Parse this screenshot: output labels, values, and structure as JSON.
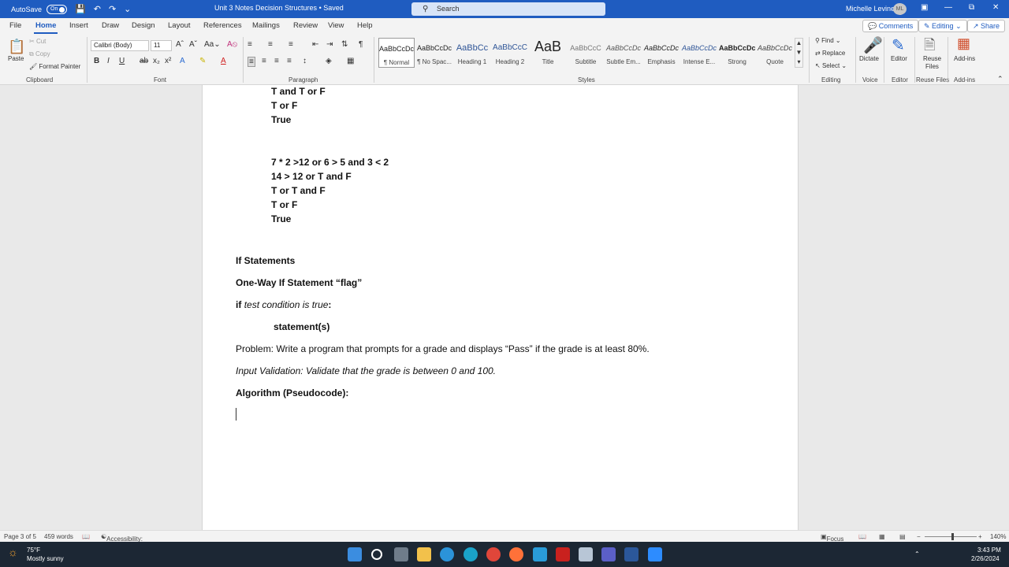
{
  "titlebar": {
    "autosave_label": "AutoSave",
    "autosave_state": "On",
    "doc_title": "Unit 3 Notes Decision Structures",
    "saved_status": "• Saved",
    "search_placeholder": "Search",
    "user_name": "Michelle Levine",
    "user_initials": "ML"
  },
  "ribbon_tabs": [
    "File",
    "Home",
    "Insert",
    "Draw",
    "Design",
    "Layout",
    "References",
    "Mailings",
    "Review",
    "View",
    "Help"
  ],
  "ribbon_buttons": {
    "comments": "Comments",
    "editing": "Editing",
    "share": "Share"
  },
  "clipboard": {
    "paste": "Paste",
    "cut": "Cut",
    "copy": "Copy",
    "format_painter": "Format Painter",
    "label": "Clipboard"
  },
  "font": {
    "family": "Calibri (Body)",
    "size": "11",
    "label": "Font"
  },
  "paragraph": {
    "label": "Paragraph"
  },
  "styles": {
    "label": "Styles",
    "items": [
      {
        "preview": "AaBbCcDc",
        "name": "¶ Normal"
      },
      {
        "preview": "AaBbCcDc",
        "name": "¶ No Spac..."
      },
      {
        "preview": "AaBbCc",
        "name": "Heading 1"
      },
      {
        "preview": "AaBbCcC",
        "name": "Heading 2"
      },
      {
        "preview": "AaB",
        "name": "Title"
      },
      {
        "preview": "AaBbCcC",
        "name": "Subtitle"
      },
      {
        "preview": "AaBbCcDc",
        "name": "Subtle Em..."
      },
      {
        "preview": "AaBbCcDc",
        "name": "Emphasis"
      },
      {
        "preview": "AaBbCcDc",
        "name": "Intense E..."
      },
      {
        "preview": "AaBbCcDc",
        "name": "Strong"
      },
      {
        "preview": "AaBbCcDc",
        "name": "Quote"
      }
    ]
  },
  "editing": {
    "find": "Find",
    "replace": "Replace",
    "select": "Select",
    "label": "Editing"
  },
  "voice": {
    "dictate": "Dictate",
    "label": "Voice"
  },
  "editor": {
    "editor": "Editor",
    "label": "Editor"
  },
  "reuse": {
    "line1": "Reuse",
    "line2": "Files",
    "label": "Reuse Files"
  },
  "addins": {
    "addins": "Add-ins",
    "label": "Add-ins"
  },
  "document": {
    "block1": [
      "T and T or F",
      "T or F",
      "True"
    ],
    "block2": [
      "7 * 2 >12 or 6 > 5 and 3 < 2",
      "14 > 12 or T and F",
      "T or T and F",
      "T or F",
      "True"
    ],
    "heading_if": "If Statements",
    "heading_oneway": "One-Way If Statement “flag”",
    "if_keyword": "if",
    "if_condition": "test condition is true",
    "if_colon": ":",
    "statement": "statement(s)",
    "problem": "Problem: Write a program that prompts for a grade and displays “Pass” if the grade is at least 80%.",
    "input_validation": "Input Validation: Validate that the grade is between 0 and 100.",
    "algorithm": "Algorithm (Pseudocode):"
  },
  "statusbar": {
    "page": "Page 3 of 5",
    "words": "459 words",
    "accessibility": "Accessibility: Good to go",
    "focus": "Focus",
    "zoom": "140%"
  },
  "taskbar": {
    "temp": "75°F",
    "weather": "Mostly sunny",
    "time": "3:43 PM",
    "date": "2/26/2024"
  },
  "colors": {
    "titlebar": "#1f5cc0",
    "taskbar": "#1c2734"
  }
}
